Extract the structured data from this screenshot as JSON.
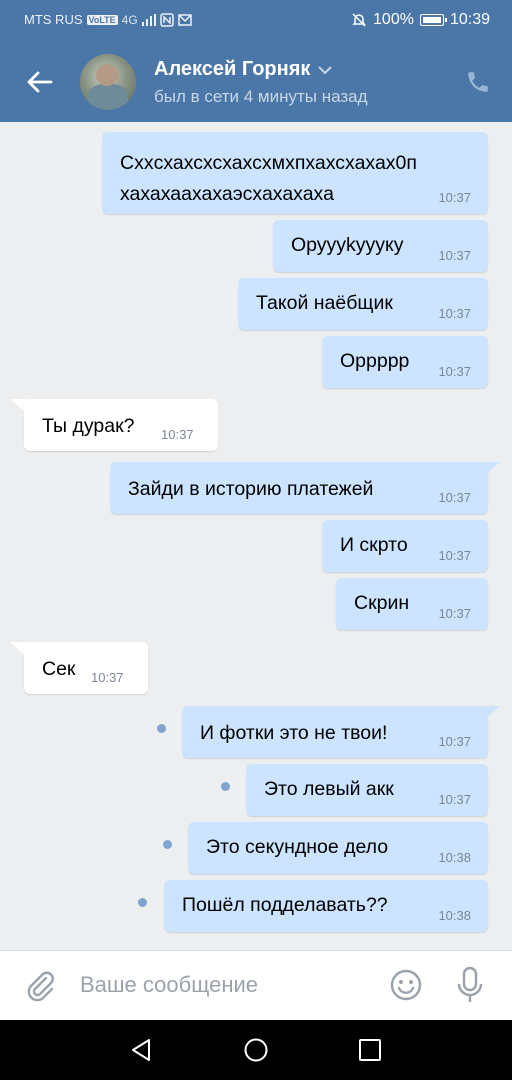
{
  "status_bar": {
    "carrier": "MTS RUS",
    "volte": "VoLTE",
    "network": "4G",
    "battery": "100%",
    "time": "10:39"
  },
  "header": {
    "name": "Алексей Горняк",
    "status": "был в сети 4 минуты назад"
  },
  "messages": [
    {
      "dir": "out",
      "lines": [
        "Схxсхахсхсхахсхмхпхахсхахах0п",
        "хахахаахахаэсхахахаха"
      ],
      "time": "10:37",
      "unread": false
    },
    {
      "dir": "out",
      "lines": [
        "Оруууkуууку"
      ],
      "time": "10:37",
      "unread": false
    },
    {
      "dir": "out",
      "lines": [
        "Такой наёбщик"
      ],
      "time": "10:37",
      "unread": false
    },
    {
      "dir": "out",
      "lines": [
        "Орpppp"
      ],
      "time": "10:37",
      "unread": false
    },
    {
      "dir": "in",
      "lines": [
        "Ты дурак?"
      ],
      "time": "10:37",
      "unread": false
    },
    {
      "dir": "out",
      "lines": [
        "Зайди в историю платежей"
      ],
      "time": "10:37",
      "unread": false
    },
    {
      "dir": "out",
      "lines": [
        "И скрто"
      ],
      "time": "10:37",
      "unread": false
    },
    {
      "dir": "out",
      "lines": [
        "Скрин"
      ],
      "time": "10:37",
      "unread": false
    },
    {
      "dir": "in",
      "lines": [
        "Сек"
      ],
      "time": "10:37",
      "unread": false
    },
    {
      "dir": "out",
      "lines": [
        "И фотки это не твои!"
      ],
      "time": "10:37",
      "unread": true
    },
    {
      "dir": "out",
      "lines": [
        "Это левый акк"
      ],
      "time": "10:37",
      "unread": true
    },
    {
      "dir": "out",
      "lines": [
        "Это секундное дело"
      ],
      "time": "10:38",
      "unread": true
    },
    {
      "dir": "out",
      "lines": [
        "Пошёл подделавать??"
      ],
      "time": "10:38",
      "unread": true
    }
  ],
  "composer": {
    "placeholder": "Ваше сообщение"
  },
  "colors": {
    "header": "#4a76a8",
    "bubble_out": "#cce4ff",
    "bubble_in": "#ffffff",
    "background": "#edeef0",
    "unread_dot": "#7fa4cf"
  },
  "icons": [
    "back-arrow-icon",
    "chevron-down-icon",
    "phone-icon",
    "paperclip-icon",
    "emoji-icon",
    "microphone-icon",
    "nav-back-icon",
    "nav-home-icon",
    "nav-recent-icon"
  ]
}
